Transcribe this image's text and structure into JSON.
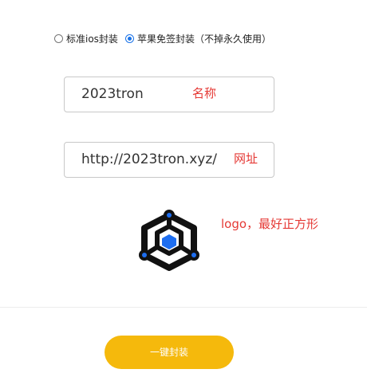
{
  "pack_mode": {
    "options": [
      {
        "label": "标准ios封装",
        "selected": false
      },
      {
        "label": "苹果免签封装（不掉永久使用）",
        "selected": true
      }
    ]
  },
  "name_field": {
    "value": "2023tron",
    "note": "名称"
  },
  "url_field": {
    "value": "http://2023tron.xyz/",
    "note": "网址"
  },
  "logo": {
    "icon": "hexagon-cube-logo-icon",
    "note": "logo，最好正方形",
    "accent": "#1e6ef0"
  },
  "submit": {
    "label": "一键封装",
    "color": "#f5b90c"
  }
}
